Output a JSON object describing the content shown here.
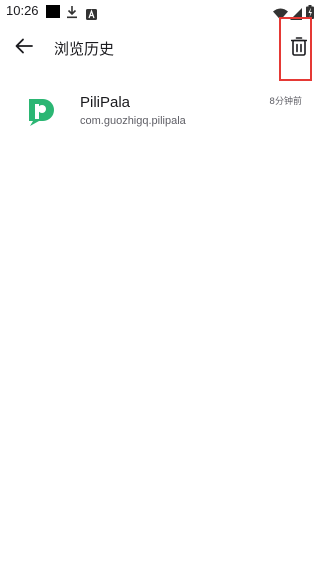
{
  "status_bar": {
    "time": "10:26",
    "icons": [
      "notification-square-icon",
      "download-icon",
      "a-letter-icon",
      "wifi-icon",
      "signal-icon",
      "battery-icon"
    ]
  },
  "app_bar": {
    "title": "浏览历史",
    "back_icon": "arrow-back-icon",
    "delete_icon": "trash-icon"
  },
  "history": [
    {
      "app_name": "PiliPala",
      "package": "com.guozhigq.pilipala",
      "time": "8分钟前",
      "icon": "pilipala-logo-icon",
      "icon_color": "#2bb673"
    }
  ],
  "colors": {
    "background": "#ffffff",
    "highlight_border": "#e53935",
    "text_primary": "#1b1b1f",
    "text_secondary": "#5f5f66"
  }
}
